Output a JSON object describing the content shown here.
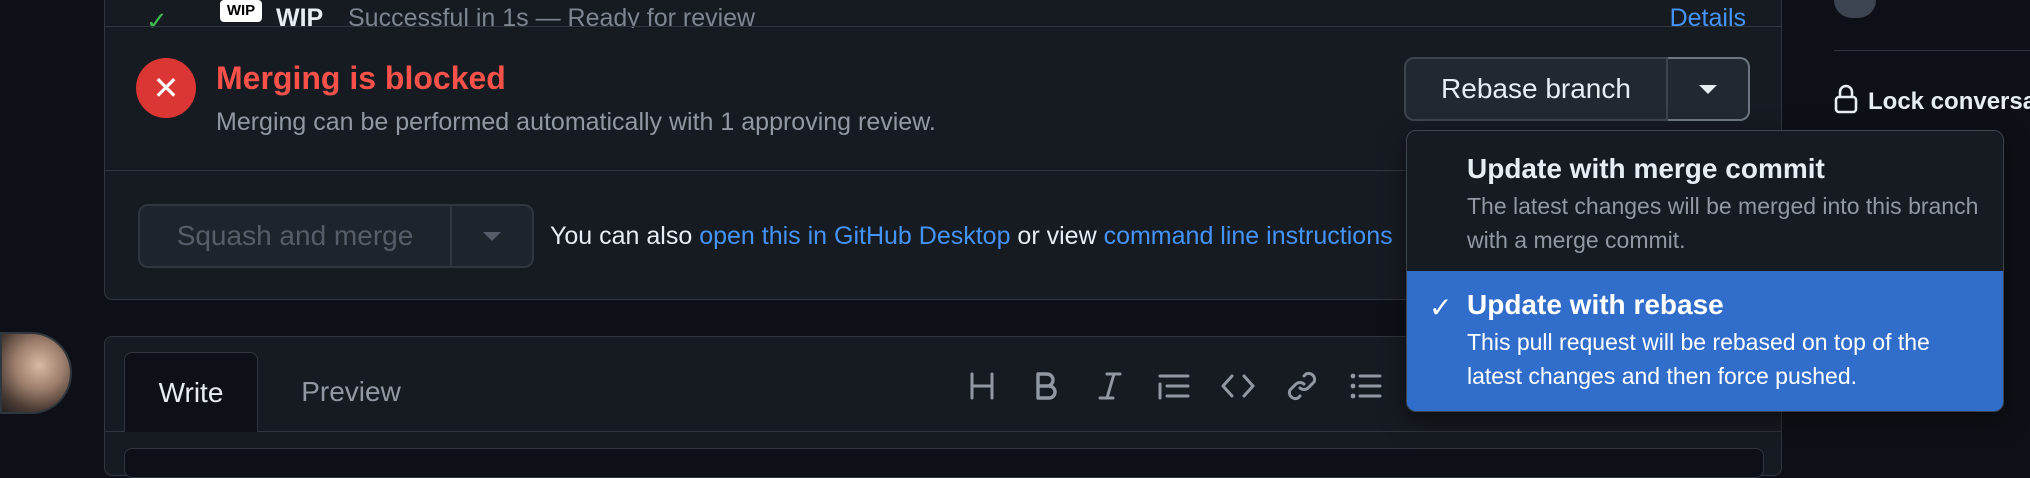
{
  "check": {
    "logo_text": "WIP",
    "name": "WIP",
    "description": "Successful in 1s — Ready for review",
    "details_link": "Details"
  },
  "merge_status": {
    "title": "Merging is blocked",
    "subtitle": "Merging can be performed automatically with 1 approving review."
  },
  "update_branch": {
    "button_label": "Rebase branch"
  },
  "merge": {
    "button_label": "Squash and merge",
    "also_text": "You can also ",
    "desktop_link": "open this in GitHub Desktop",
    "or_view": " or view ",
    "cli_link": "command line instructions"
  },
  "dropdown": {
    "items": [
      {
        "title": "Update with merge commit",
        "description": "The latest changes will be merged into this branch with a merge commit.",
        "selected": false
      },
      {
        "title": "Update with rebase",
        "description": "This pull request will be rebased on top of the latest changes and then force pushed.",
        "selected": true
      }
    ]
  },
  "editor": {
    "tabs": [
      "Write",
      "Preview"
    ],
    "toolbar_icons": [
      "heading-icon",
      "bold-icon",
      "italic-icon",
      "quote-icon",
      "code-icon",
      "link-icon",
      "list-icon"
    ]
  },
  "sidebar": {
    "lock_label": "Lock conversation"
  },
  "colors": {
    "blocked_red": "#da3633",
    "link_blue": "#4493f8",
    "selected_blue": "#316dca",
    "success_green": "#3fb950"
  }
}
